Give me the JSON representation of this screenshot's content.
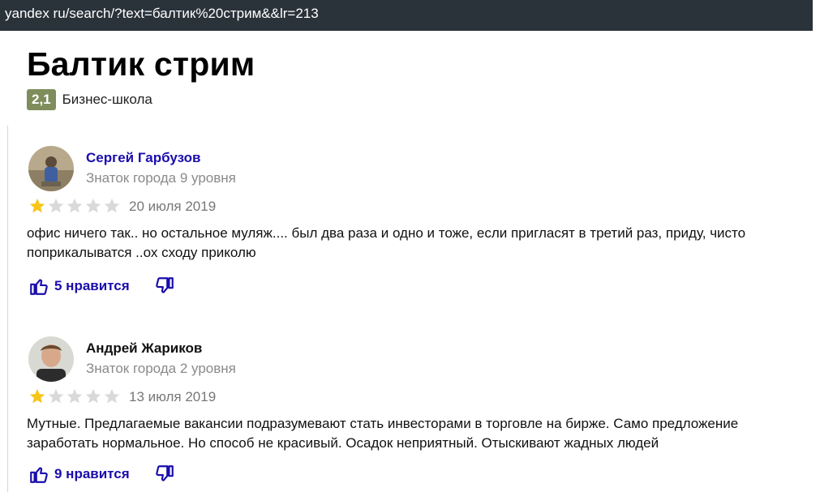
{
  "addressbar": {
    "url": "yandex ru/search/?text=балтик%20стрим&&lr=213"
  },
  "org": {
    "title": "Балтик стрим",
    "rating": "2,1",
    "category": "Бизнес-школа"
  },
  "reviews": [
    {
      "author": "Сергей Гарбузов",
      "level": "Знаток города 9 уровня",
      "stars": 1,
      "date": "20 июля 2019",
      "text": "офис ничего так.. но остальное муляж.... был два раза и одно и тоже, если пригласят в третий раз, приду, чисто поприкалыватся ..ох сходу приколю",
      "likes": "5 нравится"
    },
    {
      "author": "Андрей Жариков",
      "level": "Знаток города 2 уровня",
      "stars": 1,
      "date": "13 июля 2019",
      "text": "Мутные. Предлагаемые вакансии подразумевают стать инвесторами в торговле на бирже. Само предложение заработать нормальное. Но способ не красивый. Осадок неприятный. Отыскивают жадных людей",
      "likes": "9 нравится"
    }
  ],
  "colors": {
    "link": "#1a0dab",
    "star_on": "#f5c518",
    "star_off": "#d9d9d9",
    "badge": "#7e8d5b"
  }
}
